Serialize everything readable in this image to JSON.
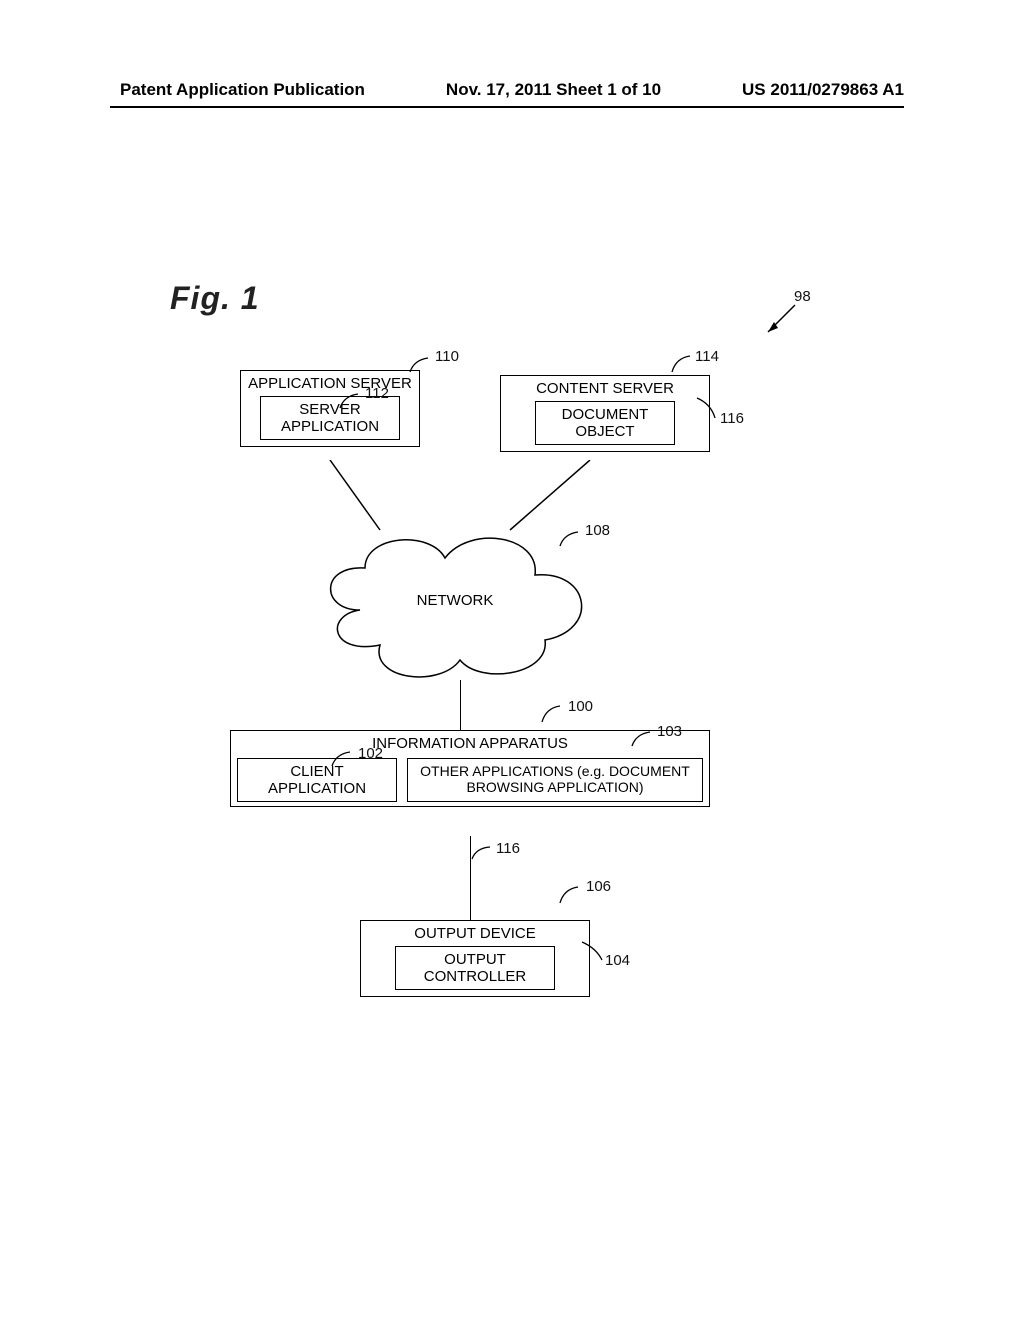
{
  "header": {
    "left": "Patent Application Publication",
    "center": "Nov. 17, 2011  Sheet 1 of 10",
    "right": "US 2011/0279863 A1"
  },
  "figure_label": "Fig. 1",
  "refs": {
    "r98": "98",
    "r100": "100",
    "r102": "102",
    "r103": "103",
    "r104": "104",
    "r106": "106",
    "r108": "108",
    "r110": "110",
    "r112": "112",
    "r114": "114",
    "r116a": "116",
    "r116b": "116"
  },
  "boxes": {
    "app_server": {
      "title": "APPLICATION SERVER",
      "inner": "SERVER APPLICATION"
    },
    "content_server": {
      "title": "CONTENT SERVER",
      "inner": "DOCUMENT OBJECT"
    },
    "network": "NETWORK",
    "info_apparatus": {
      "title": "INFORMATION APPARATUS",
      "client": "CLIENT APPLICATION",
      "other": "OTHER APPLICATIONS (e.g. DOCUMENT BROWSING APPLICATION)"
    },
    "output_device": {
      "title": "OUTPUT DEVICE",
      "inner": "OUTPUT CONTROLLER"
    }
  }
}
